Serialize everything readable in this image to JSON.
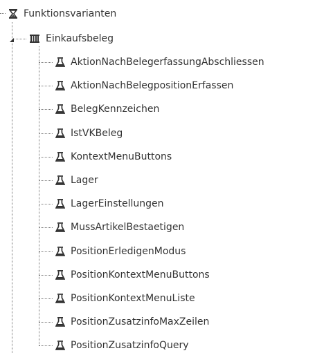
{
  "tree": {
    "root": {
      "label": "Funktionsvarianten",
      "icon": "hourglass-icon",
      "expanded": true
    },
    "group": {
      "label": "Einkaufsbeleg",
      "icon": "book-pages-icon",
      "expanded": true
    },
    "items": [
      {
        "label": "AktionNachBelegerfassungAbschliessen",
        "icon": "flask-icon"
      },
      {
        "label": "AktionNachBelegpositionErfassen",
        "icon": "flask-icon"
      },
      {
        "label": "BelegKennzeichen",
        "icon": "flask-icon"
      },
      {
        "label": "IstVKBeleg",
        "icon": "flask-icon"
      },
      {
        "label": "KontextMenuButtons",
        "icon": "flask-icon"
      },
      {
        "label": "Lager",
        "icon": "flask-icon"
      },
      {
        "label": "LagerEinstellungen",
        "icon": "flask-icon"
      },
      {
        "label": "MussArtikelBestaetigen",
        "icon": "flask-icon"
      },
      {
        "label": "PositionErledigenModus",
        "icon": "flask-icon"
      },
      {
        "label": "PositionKontextMenuButtons",
        "icon": "flask-icon"
      },
      {
        "label": "PositionKontextMenuListe",
        "icon": "flask-icon"
      },
      {
        "label": "PositionZusatzinfoMaxZeilen",
        "icon": "flask-icon"
      },
      {
        "label": "PositionZusatzinfoQuery",
        "icon": "flask-icon"
      }
    ],
    "colors": {
      "text": "#333333",
      "icon": "#333333",
      "connector": "#7a7a7a"
    }
  }
}
